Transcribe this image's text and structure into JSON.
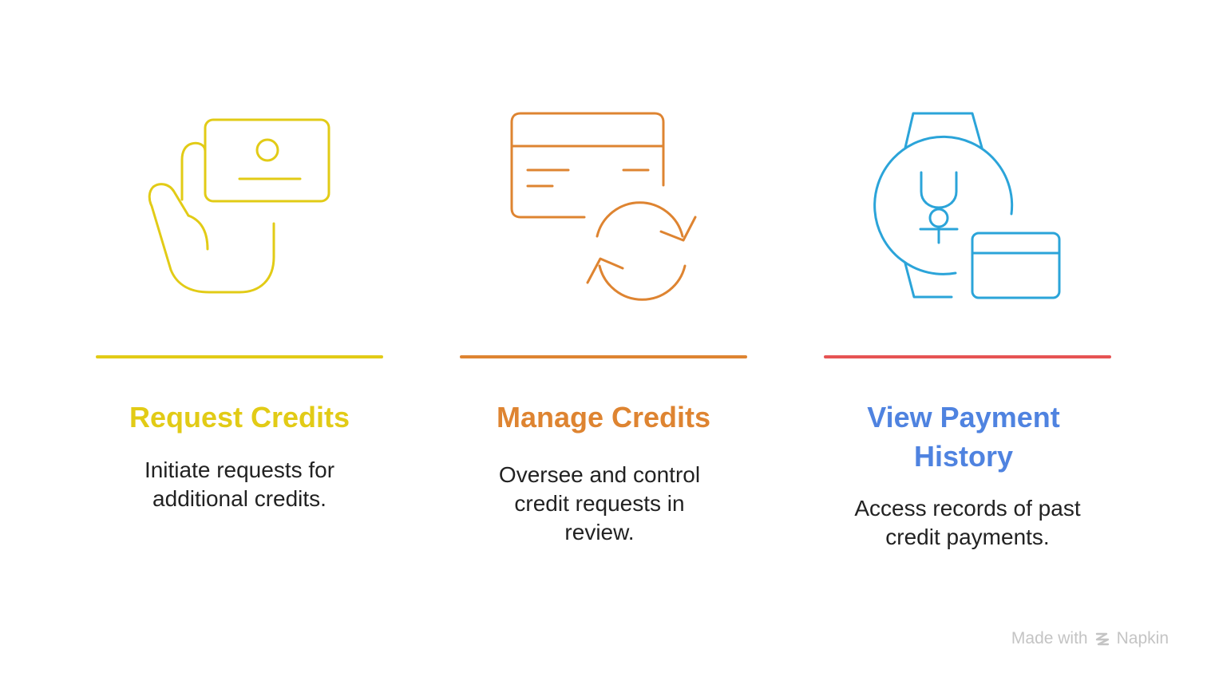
{
  "colors": {
    "yellow": "#e2cb16",
    "orange": "#de8431",
    "red": "#e65353",
    "blue": "#4f83e0",
    "cyan": "#2ba4d9",
    "text": "#222222",
    "footer": "#c4c4c4"
  },
  "steps": [
    {
      "title": "Request Credits",
      "description": "Initiate requests for additional credits.",
      "icon": "hand-holding-card-icon"
    },
    {
      "title": "Manage Credits",
      "description": "Oversee and control credit requests in review.",
      "icon": "card-refresh-icon"
    },
    {
      "title": "View Payment History",
      "description": "Access records of past credit payments.",
      "icon": "watch-card-icon"
    }
  ],
  "footer": {
    "made_with": "Made with",
    "brand": "Napkin"
  }
}
